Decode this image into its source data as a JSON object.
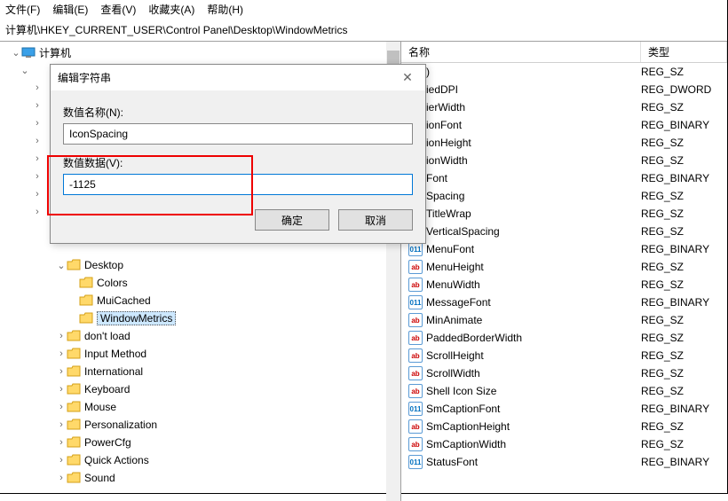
{
  "menu": {
    "file": "文件(F)",
    "edit": "编辑(E)",
    "view": "查看(V)",
    "fav": "收藏夹(A)",
    "help": "帮助(H)"
  },
  "path": "计算机\\HKEY_CURRENT_USER\\Control Panel\\Desktop\\WindowMetrics",
  "tree": {
    "root": "计算机",
    "desktop": "Desktop",
    "desktop_children": [
      "Colors",
      "MuiCached",
      "WindowMetrics"
    ],
    "siblings": [
      "don't load",
      "Input Method",
      "International",
      "Keyboard",
      "Mouse",
      "Personalization",
      "PowerCfg",
      "Quick Actions",
      "Sound"
    ]
  },
  "list": {
    "headers": {
      "name": "名称",
      "type": "类型"
    },
    "rows": [
      {
        "icon": "str",
        "name": ")",
        "type": "REG_SZ"
      },
      {
        "icon": "bin",
        "name": "iedDPI",
        "type": "REG_DWORD"
      },
      {
        "icon": "str",
        "name": "ierWidth",
        "type": "REG_SZ"
      },
      {
        "icon": "bin",
        "name": "ionFont",
        "type": "REG_BINARY"
      },
      {
        "icon": "str",
        "name": "ionHeight",
        "type": "REG_SZ"
      },
      {
        "icon": "str",
        "name": "ionWidth",
        "type": "REG_SZ"
      },
      {
        "icon": "bin",
        "name": "Font",
        "type": "REG_BINARY"
      },
      {
        "icon": "str",
        "name": "Spacing",
        "type": "REG_SZ"
      },
      {
        "icon": "str",
        "name": "TitleWrap",
        "type": "REG_SZ"
      },
      {
        "icon": "str",
        "name": "VerticalSpacing",
        "type": "REG_SZ"
      },
      {
        "icon": "bin",
        "name": "MenuFont",
        "type": "REG_BINARY"
      },
      {
        "icon": "str",
        "name": "MenuHeight",
        "type": "REG_SZ"
      },
      {
        "icon": "str",
        "name": "MenuWidth",
        "type": "REG_SZ"
      },
      {
        "icon": "bin",
        "name": "MessageFont",
        "type": "REG_BINARY"
      },
      {
        "icon": "str",
        "name": "MinAnimate",
        "type": "REG_SZ"
      },
      {
        "icon": "str",
        "name": "PaddedBorderWidth",
        "type": "REG_SZ"
      },
      {
        "icon": "str",
        "name": "ScrollHeight",
        "type": "REG_SZ"
      },
      {
        "icon": "str",
        "name": "ScrollWidth",
        "type": "REG_SZ"
      },
      {
        "icon": "str",
        "name": "Shell Icon Size",
        "type": "REG_SZ"
      },
      {
        "icon": "bin",
        "name": "SmCaptionFont",
        "type": "REG_BINARY"
      },
      {
        "icon": "str",
        "name": "SmCaptionHeight",
        "type": "REG_SZ"
      },
      {
        "icon": "str",
        "name": "SmCaptionWidth",
        "type": "REG_SZ"
      },
      {
        "icon": "bin",
        "name": "StatusFont",
        "type": "REG_BINARY"
      }
    ]
  },
  "dialog": {
    "title": "编辑字符串",
    "name_label": "数值名称(N):",
    "name_value": "IconSpacing",
    "data_label": "数值数据(V):",
    "data_value": "-1125",
    "ok": "确定",
    "cancel": "取消"
  },
  "icons": {
    "ab": "ab",
    "bin": "011"
  }
}
